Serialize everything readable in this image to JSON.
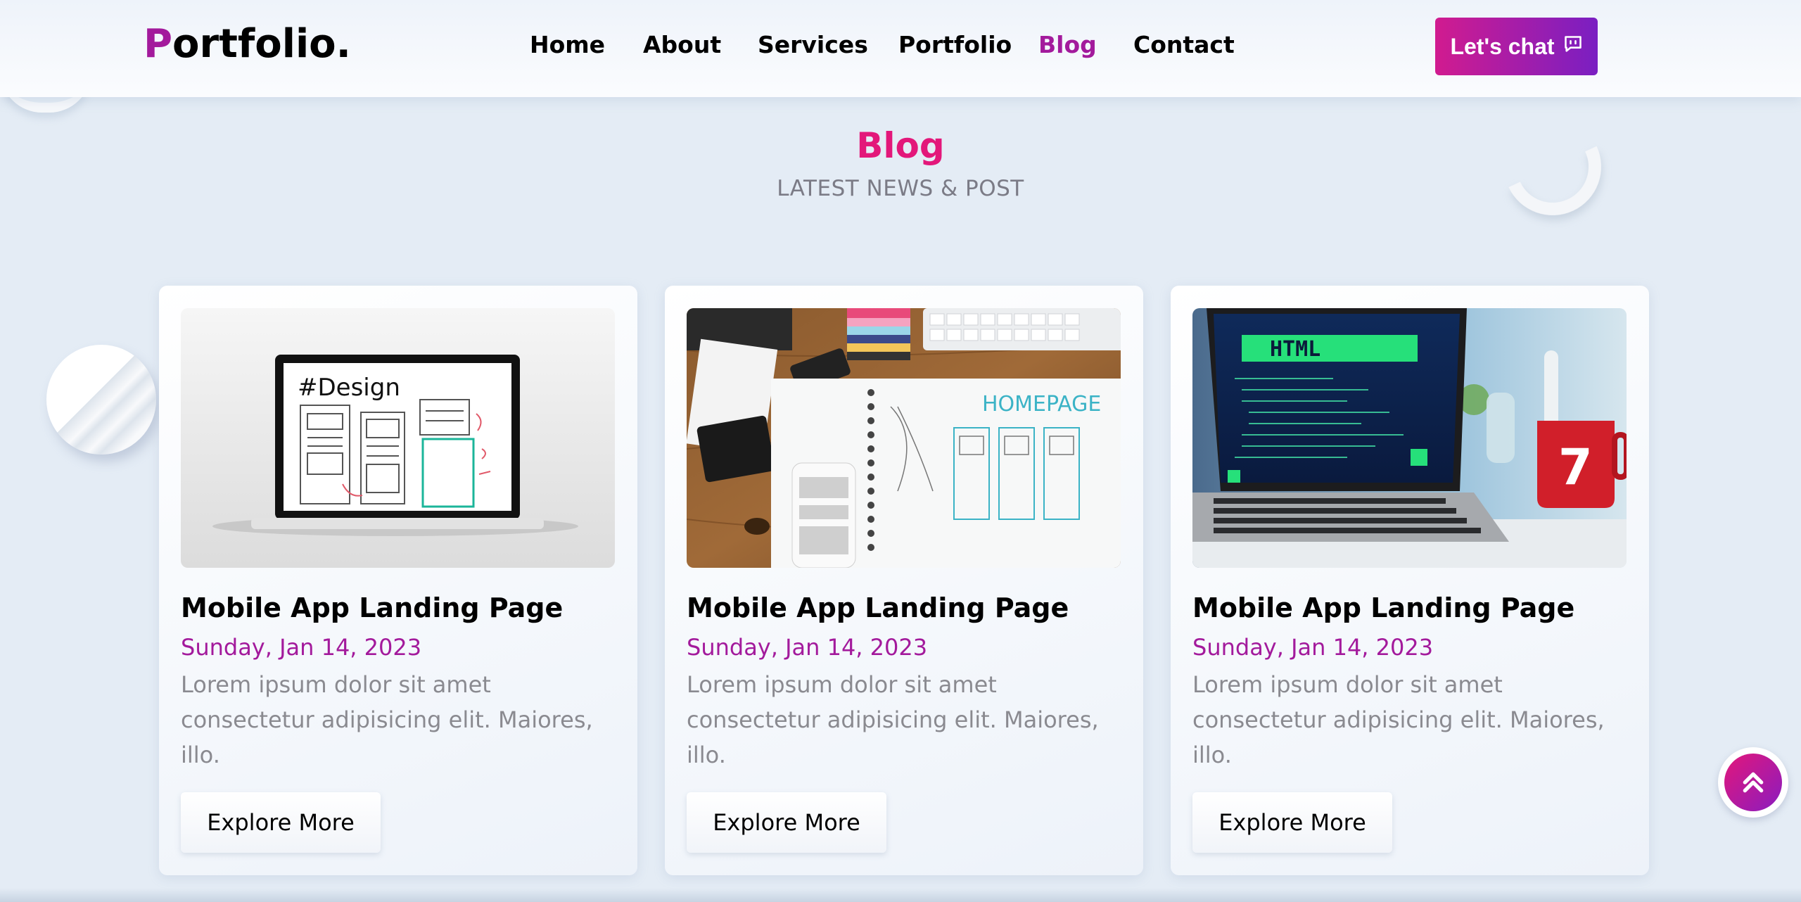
{
  "header": {
    "logo_first": "P",
    "logo_rest": "ortfolio.",
    "nav": [
      {
        "label": "Home",
        "active": false
      },
      {
        "label": "About",
        "active": false
      },
      {
        "label": "Services",
        "active": false
      },
      {
        "label": "Portfolio",
        "active": false
      },
      {
        "label": "Blog",
        "active": true
      },
      {
        "label": "Contact",
        "active": false
      }
    ],
    "chat_label": "Let's chat",
    "chat_icon": "chat-bubble-icon"
  },
  "section": {
    "title": "Blog",
    "subtitle": "LATEST NEWS & POST"
  },
  "cards": [
    {
      "image": "laptop-design-wireframe-image",
      "image_text": "#Design",
      "title": "Mobile App Landing Page",
      "date": "Sunday, Jan 14, 2023",
      "text": "Lorem ipsum dolor sit amet consectetur adipisicing elit. Maiores, illo.",
      "button": "Explore More"
    },
    {
      "image": "desk-homepage-sketch-image",
      "image_text": "HOMEPAGE",
      "title": "Mobile App Landing Page",
      "date": "Sunday, Jan 14, 2023",
      "text": "Lorem ipsum dolor sit amet consectetur adipisicing elit. Maiores, illo.",
      "button": "Explore More"
    },
    {
      "image": "laptop-html-code-image",
      "image_text": "HTML",
      "image_text_2": "7",
      "title": "Mobile App Landing Page",
      "date": "Sunday, Jan 14, 2023",
      "text": "Lorem ipsum dolor sit amet consectetur adipisicing elit. Maiores, illo.",
      "button": "Explore More"
    }
  ],
  "scroll_top_icon": "double-chevron-up-icon",
  "colors": {
    "accent_purple": "#a31a9c",
    "accent_pink": "#e3177a",
    "gradient_start": "#d11b8f",
    "gradient_end": "#7a1fc2",
    "background": "#e4ecf5"
  }
}
